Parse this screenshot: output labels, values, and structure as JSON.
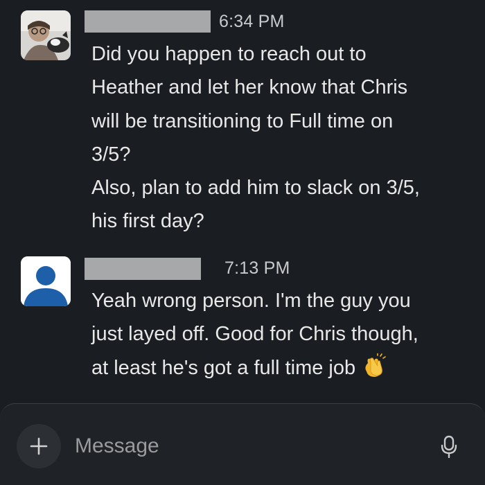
{
  "messages": [
    {
      "sender_redacted": true,
      "time": "6:34 PM",
      "lines": [
        "Did you happen to reach out to",
        "Heather and let her know that Chris",
        "will be transitioning to Full time on",
        "3/5?",
        "Also, plan to add him to slack on 3/5,",
        "his first day?"
      ]
    },
    {
      "sender_redacted": true,
      "time": "7:13 PM",
      "lines": [
        "Yeah wrong person. I'm the guy you",
        "just layed off. Good for Chris though,",
        "at least he's got a full time job"
      ],
      "trailing_emoji": "clapping-hands-icon"
    }
  ],
  "composer": {
    "placeholder": "Message",
    "value": ""
  },
  "icons": {
    "add": "plus-icon",
    "microphone": "microphone-icon"
  },
  "colors": {
    "background": "#1a1d21",
    "redaction_bar": "#a7a8aa",
    "default_avatar_bg": "#ffffff",
    "default_avatar_figure": "#1d5fa8"
  }
}
